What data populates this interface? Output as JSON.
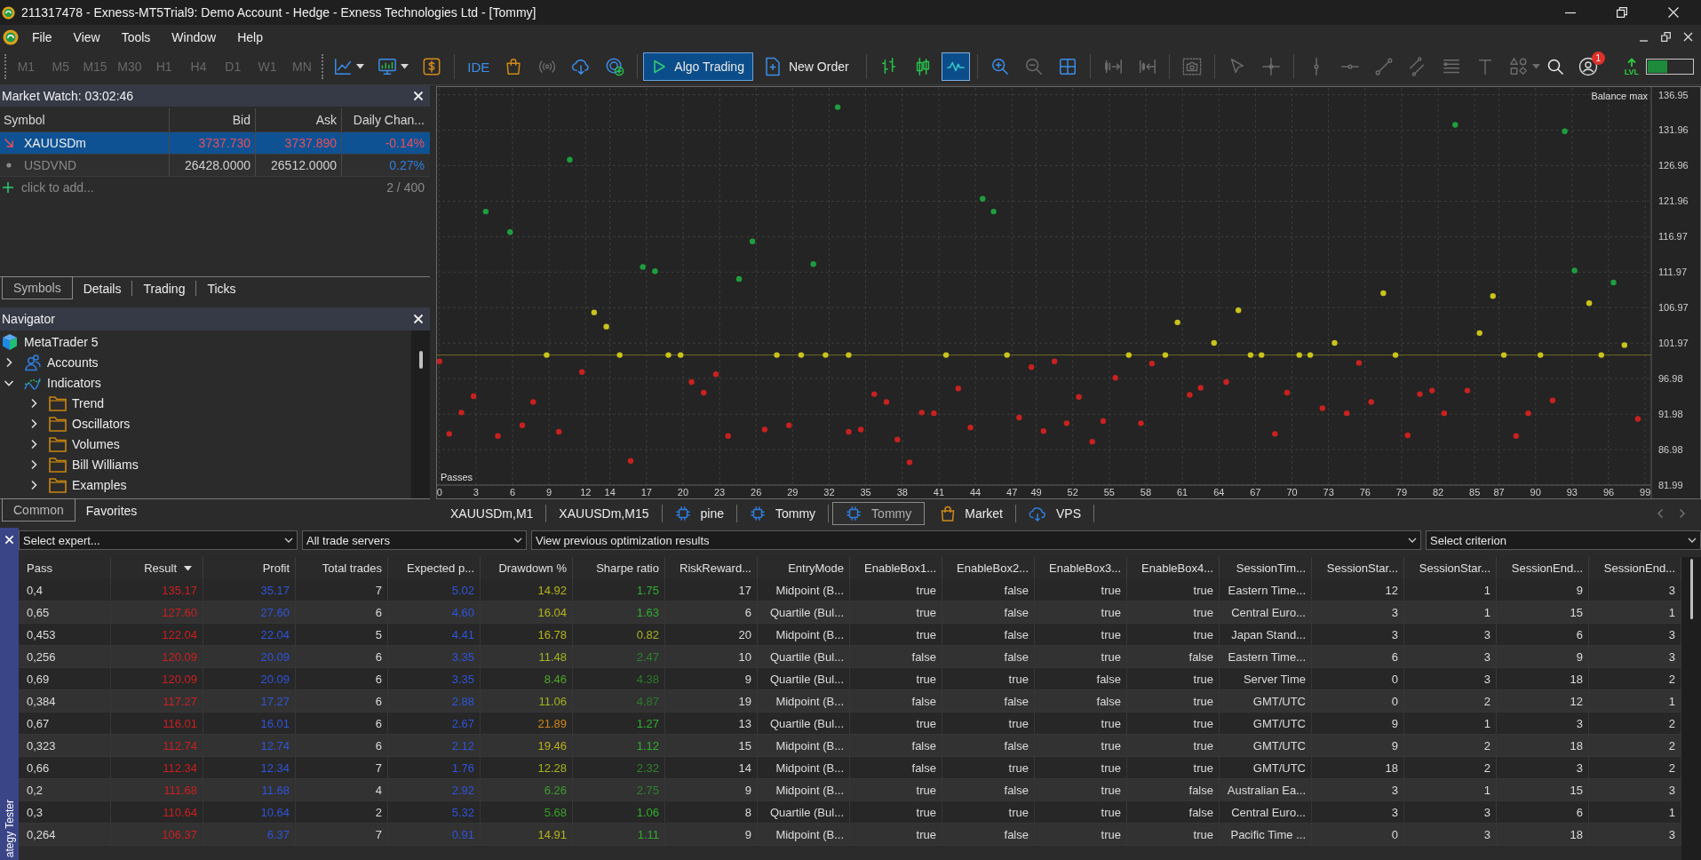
{
  "window": {
    "title": "211317478 - Exness-MT5Trial9: Demo Account - Hedge - Exness Technologies Ltd - [Tommy]"
  },
  "menu": [
    {
      "label": "File"
    },
    {
      "label": "View"
    },
    {
      "label": "Tools"
    },
    {
      "label": "Window"
    },
    {
      "label": "Help"
    }
  ],
  "timeframes": [
    {
      "label": "M1",
      "disabled": true
    },
    {
      "label": "M5",
      "disabled": true
    },
    {
      "label": "M15",
      "disabled": true
    },
    {
      "label": "M30",
      "disabled": true
    },
    {
      "label": "H1",
      "disabled": true
    },
    {
      "label": "H4",
      "disabled": true
    },
    {
      "label": "D1",
      "disabled": true
    },
    {
      "label": "W1",
      "disabled": true
    },
    {
      "label": "MN",
      "disabled": true
    }
  ],
  "toolbar": [
    [
      {
        "disabled": false
      },
      {
        "disabled": false
      },
      {
        "disabled": false
      }
    ],
    [
      {
        "label": "IDE",
        "disabled": false
      },
      {
        "disabled": false
      },
      {
        "disabled": true
      },
      {
        "disabled": false
      },
      {
        "disabled": false
      }
    ],
    [
      {
        "label": "Algo Trading",
        "on": true
      },
      {
        "label": "New Order",
        "on": false
      }
    ],
    [
      {
        "selected": false
      },
      {
        "selected": false
      },
      {
        "selected": true
      }
    ],
    [
      {
        "disabled": false
      },
      {
        "disabled": true
      },
      {
        "disabled": false
      }
    ],
    [
      {
        "disabled": true
      },
      {
        "disabled": true
      }
    ],
    [
      {
        "disabled": true
      }
    ],
    [
      {
        "disabled": true
      },
      {
        "disabled": true
      }
    ],
    [
      {
        "disabled": true
      },
      {
        "disabled": true
      },
      {
        "disabled": true
      },
      {
        "disabled": true
      },
      {
        "disabled": true
      },
      {
        "disabled": true
      },
      {
        "disabled": true
      }
    ]
  ],
  "toolbar_right": {
    "notification_badge": "1",
    "level_label": "LVL",
    "level": 0.43
  },
  "market_watch": {
    "title": "Market Watch: 03:02:46",
    "columns": [
      "Symbol",
      "Bid",
      "Ask",
      "Daily Chan..."
    ],
    "rows": [
      {
        "symbol": "XAUUSDm",
        "kind": "falling",
        "selected": true,
        "bid": {
          "text": "3737.730",
          "color": "#e8505b"
        },
        "ask": {
          "text": "3737.890",
          "color": "#e8505b"
        },
        "change": {
          "text": "-0.14%",
          "color": "#e8505b"
        }
      },
      {
        "symbol": "USDVND",
        "kind": "idle",
        "selected": false,
        "bid": {
          "text": "26428.0000",
          "color": "#d2d2d2"
        },
        "ask": {
          "text": "26512.0000",
          "color": "#d2d2d2"
        },
        "change": {
          "text": "0.27%",
          "color": "#2f7fe0"
        }
      }
    ],
    "add_label": "click to add...",
    "count": "2 / 400",
    "tabs": [
      {
        "label": "Symbols",
        "selected": true
      },
      {
        "label": "Details",
        "selected": false
      },
      {
        "label": "Trading",
        "selected": false
      },
      {
        "label": "Ticks",
        "selected": false
      }
    ]
  },
  "navigator": {
    "title": "Navigator",
    "tree": [
      {
        "label": "MetaTrader 5",
        "kind": "root",
        "children": [
          {
            "label": "Accounts",
            "kind": "accounts",
            "expanded": false
          },
          {
            "label": "Indicators",
            "kind": "indicators",
            "expanded": true,
            "children": [
              {
                "label": "Trend",
                "kind": "folder",
                "expanded": false
              },
              {
                "label": "Oscillators",
                "kind": "folder",
                "expanded": false
              },
              {
                "label": "Volumes",
                "kind": "folder",
                "expanded": false
              },
              {
                "label": "Bill Williams",
                "kind": "folder",
                "expanded": false
              },
              {
                "label": "Examples",
                "kind": "folder",
                "expanded": false
              }
            ]
          }
        ]
      }
    ],
    "tabs": [
      {
        "label": "Common",
        "selected": true
      },
      {
        "label": "Favorites",
        "selected": false
      }
    ]
  },
  "chart": {
    "chart_data": {
      "type": "scatter",
      "xlabel": "Passes",
      "ylabel": "Balance max",
      "grid": true,
      "xlim": [
        -0.2,
        99.5
      ],
      "ylim": [
        81.99,
        137.9
      ],
      "xticks": [
        0,
        3,
        6,
        9,
        12,
        14,
        17,
        20,
        23,
        26,
        29,
        32,
        35,
        38,
        41,
        44,
        47,
        49,
        52,
        55,
        58,
        61,
        64,
        67,
        70,
        73,
        76,
        79,
        82,
        85,
        87,
        90,
        93,
        96,
        99
      ],
      "yticks": [
        81.99,
        86.98,
        91.98,
        96.98,
        101.97,
        106.97,
        111.97,
        116.97,
        121.96,
        126.96,
        131.96,
        136.95
      ],
      "series": [
        {
          "color": "#1e9e3e",
          "x": [
            3.8,
            5.8,
            10.7,
            16.7,
            17.7,
            24.6,
            25.7,
            30.7,
            32.7,
            44.6,
            45.5,
            83.4,
            92.4,
            93.2,
            96.4
          ],
          "values": [
            120.5,
            117.6,
            127.8,
            112.7,
            112.1,
            111.0,
            116.3,
            113.1,
            135.2,
            122.3,
            120.5,
            132.7,
            131.8,
            112.2,
            110.5
          ]
        },
        {
          "color": "#c9c31c",
          "x": [
            8.8,
            12.7,
            13.7,
            14.8,
            18.8,
            19.8,
            27.7,
            29.7,
            31.7,
            33.6,
            41.6,
            46.6,
            56.6,
            59.6,
            60.6,
            63.6,
            65.6,
            66.6,
            67.5,
            70.6,
            71.5,
            73.5,
            77.5,
            78.5,
            85.4,
            86.5,
            87.4,
            90.4,
            94.4,
            95.4,
            97.3
          ],
          "values": [
            100.3,
            106.3,
            104.3,
            100.3,
            100.3,
            100.3,
            100.3,
            100.3,
            100.3,
            100.3,
            100.3,
            100.3,
            100.3,
            100.3,
            104.9,
            102.0,
            106.6,
            100.3,
            100.3,
            100.3,
            100.3,
            102.0,
            109.0,
            100.3,
            103.4,
            108.6,
            100.3,
            100.3,
            107.6,
            100.3,
            101.7
          ]
        },
        {
          "color": "#c8211f",
          "x": [
            0.0,
            0.8,
            1.8,
            2.8,
            4.8,
            6.8,
            7.7,
            9.8,
            11.7,
            15.7,
            20.7,
            21.7,
            22.7,
            23.7,
            26.7,
            28.7,
            33.6,
            34.6,
            35.7,
            36.7,
            37.6,
            38.6,
            39.6,
            40.6,
            42.6,
            43.6,
            47.6,
            48.6,
            49.6,
            50.5,
            51.5,
            52.5,
            53.6,
            54.5,
            55.5,
            57.6,
            58.5,
            61.6,
            62.5,
            64.6,
            68.6,
            69.6,
            72.5,
            74.5,
            75.5,
            76.5,
            79.5,
            80.5,
            81.5,
            82.5,
            84.4,
            88.4,
            89.4,
            91.4,
            98.4
          ],
          "values": [
            99.4,
            89.2,
            92.2,
            94.5,
            88.9,
            90.4,
            93.7,
            89.5,
            97.9,
            85.4,
            96.5,
            95.0,
            97.6,
            88.9,
            89.8,
            90.4,
            89.5,
            89.8,
            94.8,
            93.7,
            88.4,
            85.2,
            92.2,
            92.1,
            95.6,
            90.1,
            91.5,
            98.6,
            89.6,
            99.4,
            90.7,
            94.4,
            88.1,
            91.0,
            97.1,
            90.7,
            99.1,
            94.7,
            95.7,
            96.5,
            89.2,
            95.0,
            92.8,
            92.1,
            99.2,
            93.7,
            89.0,
            94.8,
            95.3,
            92.1,
            95.3,
            88.9,
            92.1,
            93.9,
            91.3
          ]
        }
      ],
      "ref_lines": [
        {
          "axis": "y",
          "value": 100.3,
          "color": "#6b6a22"
        }
      ]
    }
  },
  "chart_tabs": [
    {
      "label": "XAUUSDm,M1",
      "kind": "chart",
      "selected": false
    },
    {
      "label": "XAUUSDm,M15",
      "kind": "chart",
      "selected": false
    },
    {
      "label": "pine",
      "kind": "expert",
      "selected": false
    },
    {
      "label": "Tommy",
      "kind": "expert",
      "selected": false
    },
    {
      "label": "Tommy",
      "kind": "expert",
      "selected": true
    },
    {
      "label": "Market",
      "kind": "market",
      "selected": false
    },
    {
      "label": "VPS",
      "kind": "vps",
      "selected": false
    }
  ],
  "strategy_tester": {
    "title": "ategy Tester",
    "filters": [
      {
        "value": "Select expert..."
      },
      {
        "value": "All trade servers"
      },
      {
        "value": "View previous optimization results"
      },
      {
        "value": "Select criterion"
      }
    ],
    "columns": [
      {
        "label": "Pass",
        "kind": "left",
        "sorted": false
      },
      {
        "label": "Result",
        "kind": "result",
        "sorted": true
      },
      {
        "label": "Profit",
        "kind": "profit",
        "sorted": false
      },
      {
        "label": "Total trades",
        "kind": "plain",
        "sorted": false
      },
      {
        "label": "Expected p...",
        "kind": "profit",
        "sorted": false
      },
      {
        "label": "Drawdown %",
        "kind": "graded",
        "sorted": false
      },
      {
        "label": "Sharpe ratio",
        "kind": "graded",
        "sorted": false
      },
      {
        "label": "RiskReward...",
        "kind": "plain",
        "sorted": false
      },
      {
        "label": "EntryMode",
        "kind": "plain",
        "sorted": false
      },
      {
        "label": "EnableBox1...",
        "kind": "plain",
        "sorted": false
      },
      {
        "label": "EnableBox2...",
        "kind": "plain",
        "sorted": false
      },
      {
        "label": "EnableBox3...",
        "kind": "plain",
        "sorted": false
      },
      {
        "label": "EnableBox4...",
        "kind": "plain",
        "sorted": false
      },
      {
        "label": "SessionTim...",
        "kind": "plain",
        "sorted": false
      },
      {
        "label": "SessionStar...",
        "kind": "plain",
        "sorted": false
      },
      {
        "label": "SessionStar...",
        "kind": "plain",
        "sorted": false
      },
      {
        "label": "SessionEnd...",
        "kind": "plain",
        "sorted": false
      },
      {
        "label": "SessionEnd...",
        "kind": "plain",
        "sorted": false
      }
    ],
    "rows": [
      [
        "0,4",
        "135.17",
        "35.17",
        "7",
        "5.02",
        {
          "text": "14.92",
          "color": "#b4b41e"
        },
        {
          "text": "1.75",
          "color": "#2fae2f"
        },
        "17",
        "Midpoint (B...",
        "true",
        "false",
        "true",
        "true",
        "Eastern Time...",
        "12",
        "1",
        "9",
        "3"
      ],
      [
        "0,65",
        "127.60",
        "27.60",
        "6",
        "4.60",
        {
          "text": "16.04",
          "color": "#b4b41e"
        },
        {
          "text": "1.63",
          "color": "#2fae2f"
        },
        "6",
        "Quartile (Bul...",
        "true",
        "false",
        "true",
        "true",
        "Central Euro...",
        "3",
        "1",
        "15",
        "1"
      ],
      [
        "0,453",
        "122.04",
        "22.04",
        "5",
        "4.41",
        {
          "text": "16.78",
          "color": "#b4b41e"
        },
        {
          "text": "0.82",
          "color": "#a8b420"
        },
        "20",
        "Midpoint (B...",
        "true",
        "false",
        "true",
        "true",
        "Japan Stand...",
        "3",
        "3",
        "6",
        "3"
      ],
      [
        "0,256",
        "120.09",
        "20.09",
        "6",
        "3.35",
        {
          "text": "11.48",
          "color": "#a4b420"
        },
        {
          "text": "2.47",
          "color": "#2f822f"
        },
        "10",
        "Quartile (Bul...",
        "false",
        "false",
        "true",
        "false",
        "Eastern Time...",
        "6",
        "3",
        "9",
        "3"
      ],
      [
        "0,69",
        "120.09",
        "20.09",
        "6",
        "3.35",
        {
          "text": "8.46",
          "color": "#4ea82a"
        },
        {
          "text": "4.38",
          "color": "#2c7a2c"
        },
        "9",
        "Quartile (Bul...",
        "true",
        "true",
        "false",
        "true",
        "Server Time",
        "0",
        "3",
        "18",
        "2"
      ],
      [
        "0,384",
        "117.27",
        "17.27",
        "6",
        "2.88",
        {
          "text": "11.06",
          "color": "#a4b420"
        },
        {
          "text": "4.87",
          "color": "#2c7a2c"
        },
        "19",
        "Midpoint (B...",
        "false",
        "false",
        "false",
        "true",
        "GMT/UTC",
        "0",
        "2",
        "12",
        "1"
      ],
      [
        "0,67",
        "116.01",
        "16.01",
        "6",
        "2.67",
        {
          "text": "21.89",
          "color": "#d0841a"
        },
        {
          "text": "1.27",
          "color": "#2fae2f"
        },
        "13",
        "Quartile (Bul...",
        "true",
        "true",
        "true",
        "true",
        "GMT/UTC",
        "9",
        "1",
        "3",
        "2"
      ],
      [
        "0,323",
        "112.74",
        "12.74",
        "6",
        "2.12",
        {
          "text": "19.46",
          "color": "#b8b01e"
        },
        {
          "text": "1.12",
          "color": "#2fae2f"
        },
        "15",
        "Midpoint (B...",
        "false",
        "false",
        "true",
        "true",
        "GMT/UTC",
        "9",
        "2",
        "18",
        "2"
      ],
      [
        "0,66",
        "112.34",
        "12.34",
        "7",
        "1.76",
        {
          "text": "12.28",
          "color": "#a8b420"
        },
        {
          "text": "2.32",
          "color": "#2f822f"
        },
        "14",
        "Midpoint (B...",
        "false",
        "true",
        "true",
        "true",
        "GMT/UTC",
        "18",
        "2",
        "3",
        "2"
      ],
      [
        "0,2",
        "111.68",
        "11.68",
        "4",
        "2.92",
        {
          "text": "6.26",
          "color": "#3a9f2a"
        },
        {
          "text": "2.75",
          "color": "#2f822f"
        },
        "9",
        "Midpoint (B...",
        "true",
        "false",
        "true",
        "false",
        "Australian Ea...",
        "3",
        "1",
        "15",
        "3"
      ],
      [
        "0,3",
        "110.64",
        "10.64",
        "2",
        "5.32",
        {
          "text": "5.68",
          "color": "#3a9f2a"
        },
        {
          "text": "1.06",
          "color": "#2fae2f"
        },
        "8",
        "Quartile (Bul...",
        "true",
        "true",
        "true",
        "false",
        "Central Euro...",
        "3",
        "3",
        "6",
        "1"
      ],
      [
        "0,264",
        "106.37",
        "6.37",
        "7",
        "0.91",
        {
          "text": "14.91",
          "color": "#b4b41e"
        },
        {
          "text": "1.11",
          "color": "#2fae2f"
        },
        "9",
        "Midpoint (B...",
        "true",
        "false",
        "true",
        "true",
        "Pacific Time ...",
        "0",
        "3",
        "18",
        "3"
      ]
    ]
  }
}
